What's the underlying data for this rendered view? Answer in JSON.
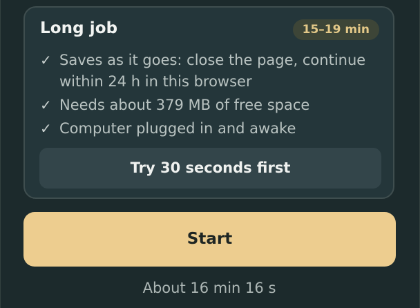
{
  "card": {
    "title": "Long job",
    "duration_badge": "15–19 min",
    "items": [
      "Saves as it goes: close the page, continue within 24 h in this browser",
      "Needs about 379 MB of free space",
      "Computer plugged in and awake"
    ],
    "check_glyph": "✓",
    "trial_button_label": "Try 30 seconds first"
  },
  "start_button_label": "Start",
  "estimate_text": "About 16 min 16 s",
  "colors": {
    "background": "#1c2a2c",
    "card": "#24363a",
    "accent": "#edcd8f",
    "badge_text": "#e3c888"
  }
}
